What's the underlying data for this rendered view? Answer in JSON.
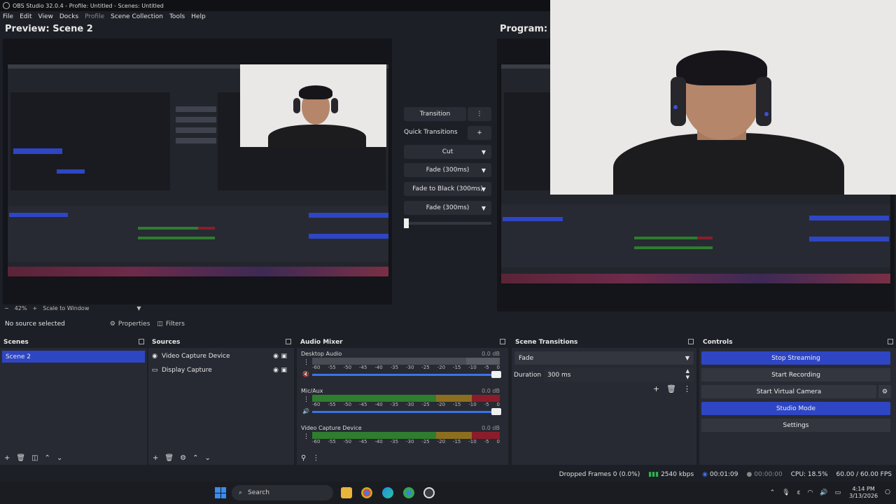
{
  "window": {
    "title": "OBS Studio 32.0.4 - Profile: Untitled - Scenes: Untitled"
  },
  "menu": [
    "File",
    "Edit",
    "View",
    "Docks",
    "Profile",
    "Scene Collection",
    "Tools",
    "Help"
  ],
  "preview": {
    "title": "Preview: Scene 2"
  },
  "program": {
    "title": "Program: S"
  },
  "transitions_panel": {
    "transition_label": "Transition",
    "quick_label": "Quick Transitions",
    "items": [
      "Cut",
      "Fade (300ms)",
      "Fade to Black (300ms)",
      "Fade (300ms)"
    ],
    "slider_value": 0
  },
  "zoom": {
    "level": "42%",
    "mode": "Scale to Window"
  },
  "source_toolbar": {
    "no_source": "No source selected",
    "properties": "Properties",
    "filters": "Filters"
  },
  "scenes": {
    "title": "Scenes",
    "items": [
      "Scene 2"
    ]
  },
  "sources": {
    "title": "Sources",
    "items": [
      "Video Capture Device",
      "Display Capture"
    ]
  },
  "audio_mixer": {
    "title": "Audio Mixer",
    "ticks": [
      "-60",
      "-55",
      "-50",
      "-45",
      "-40",
      "-35",
      "-30",
      "-25",
      "-20",
      "-15",
      "-10",
      "-5",
      "0"
    ],
    "channels": [
      {
        "name": "Desktop Audio",
        "db": "0.0 dB"
      },
      {
        "name": "Mic/Aux",
        "db": "0.0 dB"
      },
      {
        "name": "Video Capture Device",
        "db": "0.0 dB"
      }
    ]
  },
  "scene_transitions": {
    "title": "Scene Transitions",
    "type": "Fade",
    "duration_label": "Duration",
    "duration_value": "300 ms"
  },
  "controls": {
    "title": "Controls",
    "stop_streaming": "Stop Streaming",
    "start_recording": "Start Recording",
    "start_virtual_camera": "Start Virtual Camera",
    "studio_mode": "Studio Mode",
    "settings": "Settings"
  },
  "status": {
    "dropped_frames": "Dropped Frames 0 (0.0%)",
    "bitrate": "2540 kbps",
    "stream_time": "00:01:09",
    "record_time": "00:00:00",
    "cpu": "CPU: 18.5%",
    "fps": "60.00 / 60.00 FPS"
  },
  "taskbar": {
    "search_placeholder": "Search",
    "time": "4:14 PM",
    "date": "3/13/2026"
  },
  "colors": {
    "accent": "#2e46c4",
    "background": "#1d1f26",
    "dock": "#272a33"
  }
}
